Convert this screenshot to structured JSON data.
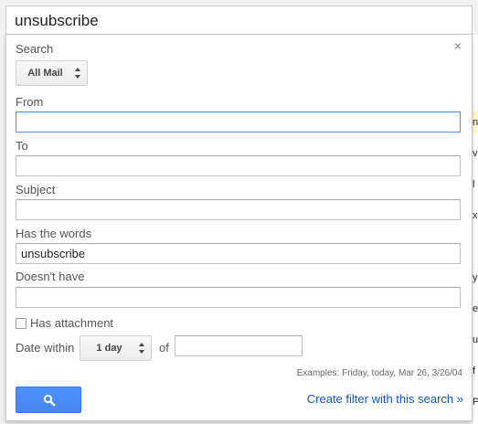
{
  "search_bar": {
    "query": "unsubscribe"
  },
  "panel": {
    "search_label": "Search",
    "scope_select": "All Mail",
    "from_label": "From",
    "from_value": "",
    "to_label": "To",
    "to_value": "",
    "subject_label": "Subject",
    "subject_value": "",
    "has_words_label": "Has the words",
    "has_words_value": "unsubscribe",
    "doesnt_have_label": "Doesn't have",
    "doesnt_have_value": "",
    "has_attachment_label": "Has attachment",
    "date_within_label": "Date within",
    "date_within_select": "1 day",
    "of_label": "of",
    "of_value": "",
    "examples": "Examples: Friday, today, Mar 26, 3/26/04",
    "create_filter": "Create filter with this search »"
  },
  "background_rows": [
    "n",
    "v",
    "l",
    "x",
    "",
    "y",
    "e",
    "u",
    "f",
    "P"
  ],
  "colors": {
    "accent": "#4d90fe",
    "link": "#1155cc",
    "highlight_row": "#fff8c8"
  },
  "icons": {
    "close": "close-icon",
    "search_button": "magnifier-icon",
    "select_arrows": "up-down-arrows-icon"
  }
}
